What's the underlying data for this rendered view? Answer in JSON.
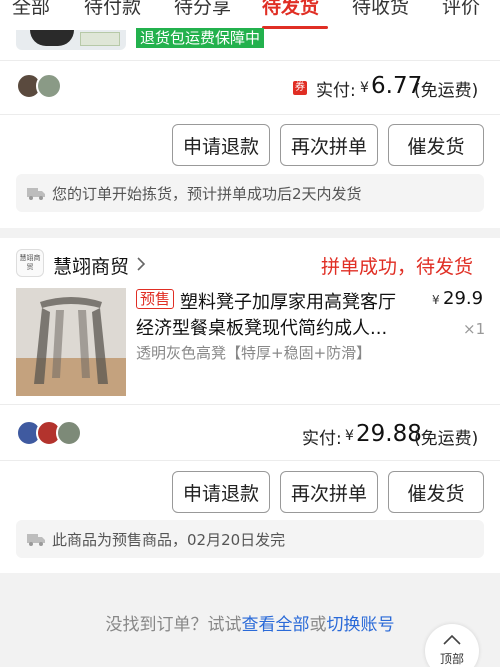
{
  "tabs": [
    "全部",
    "待付款",
    "待分享",
    "待发货",
    "待收货",
    "评价"
  ],
  "colors": {
    "accent": "#e02e24",
    "link": "#2a6ad8",
    "green": "#23b14d"
  },
  "order1": {
    "return_badge": "退货包运费保障中",
    "coupon_label": "券",
    "paid_label": "实付:",
    "currency": "¥",
    "paid_amount": "6.77",
    "shipping_note": "(免运费)",
    "buttons": {
      "refund": "申请退款",
      "regroup": "再次拼单",
      "urge": "催发货"
    },
    "notice_icon": "truck-icon",
    "notice": "您的订单开始拣货，预计拼单成功后2天内发货"
  },
  "order2": {
    "shop_logo_text": "慧翊商贸",
    "shop_name": "慧翊商贸",
    "status": "拼单成功，待发货",
    "presale_tag": "预售",
    "title_line1": "塑料凳子加厚家用高凳客厅",
    "title_line2": "经济型餐桌板凳现代简约成人...",
    "spec": "透明灰色高凳【特厚+稳固+防滑】",
    "currency": "¥",
    "unit_price": "29.9",
    "quantity": "×1",
    "paid_label": "实付:",
    "paid_amount": "29.88",
    "shipping_note": "(免运费)",
    "buttons": {
      "refund": "申请退款",
      "regroup": "再次拼单",
      "urge": "催发货"
    },
    "notice_icon": "truck-icon",
    "notice": "此商品为预售商品，02月20日发完"
  },
  "footer": {
    "hint_prefix": "没找到订单？试试",
    "view_all": "查看全部",
    "or": "或",
    "switch_account": "切换账号"
  },
  "back_to_top": {
    "label": "顶部"
  }
}
